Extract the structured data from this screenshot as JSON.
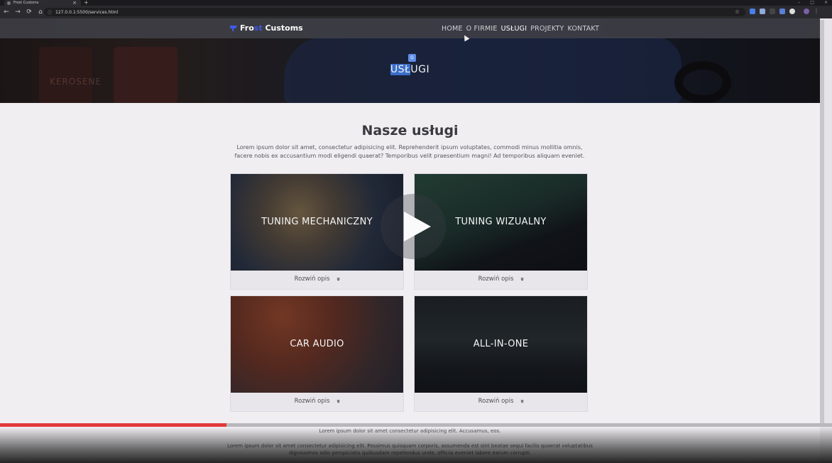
{
  "browser": {
    "tab_title": "Frost Customs",
    "tab_close": "×",
    "new_tab": "+",
    "window_controls": [
      "–",
      "□",
      "×"
    ],
    "nav": {
      "back": "←",
      "forward": "→",
      "reload": "⟳",
      "home": "⌂"
    },
    "info_icon": "ⓘ",
    "url": "127.0.0.1:5500/services.html",
    "star": "☆"
  },
  "site": {
    "brand_prefix": "Fro",
    "brand_accent": "st",
    "brand_suffix": " Customs",
    "accent_color": "#3f5be8",
    "menu": [
      {
        "label": "HOME",
        "active": false
      },
      {
        "label": "O FIRMIE",
        "active": false
      },
      {
        "label": "USŁUGI",
        "active": true
      },
      {
        "label": "PROJEKTY",
        "active": false
      },
      {
        "label": "KONTAKT",
        "active": false
      }
    ],
    "hero_title_selected": "USŁ",
    "hero_title_rest": "UGI",
    "hero_barrel_text": "KEROSENE"
  },
  "services": {
    "title": "Nasze usługi",
    "intro": "Lorem ipsum dolor sit amet, consectetur adipisicing elit. Reprehenderit ipsum voluptates, commodi minus mollitia omnis, facere nobis ex accusantium modi eligendi quaerat? Temporibus velit praesentium magni! Ad temporibus aliquam eveniet.",
    "cards": [
      {
        "name": "TUNING MECHANICZNY",
        "more": "Rozwiń opis"
      },
      {
        "name": "TUNING WIZUALNY",
        "more": "Rozwiń opis"
      },
      {
        "name": "CAR AUDIO",
        "more": "Rozwiń opis"
      },
      {
        "name": "ALL-IN-ONE",
        "more": "Rozwiń opis"
      }
    ],
    "chevron": "»"
  },
  "footer": {
    "line1": "Lorem ipsum dolor sit amet consectetur adipisicing elit. Accusamus, eos.",
    "line2": "Lorem ipsum dolor sit amet consectetur adipisicing elit. Possimus quisquam corporis, assumenda est sint beatae sequi facilis quaerat voluptatibus",
    "line3": "dignissimos odio perspiciatis quibusdam repellendus unde, officiis eveniet labore earum corrupti."
  },
  "video": {
    "progress": 0.272,
    "progress_color": "#e2393a"
  }
}
